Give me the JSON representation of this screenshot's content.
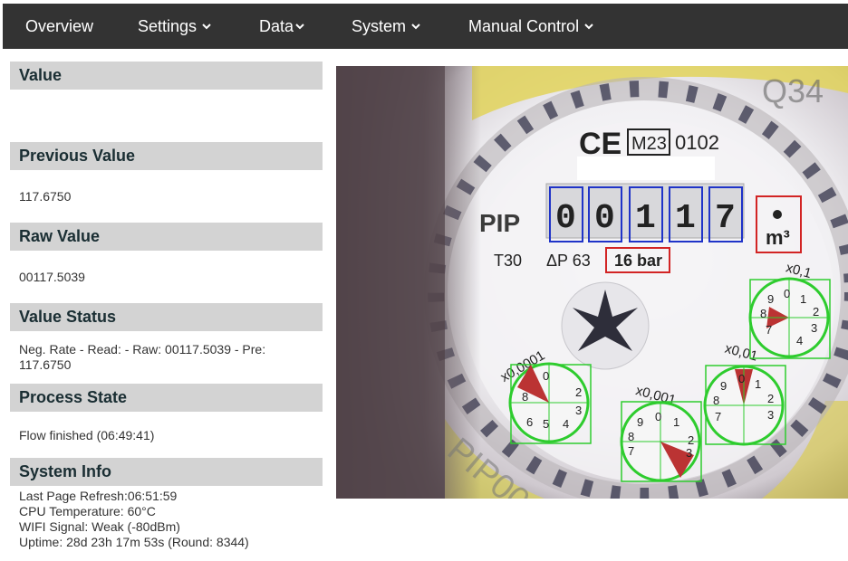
{
  "nav": {
    "items": [
      {
        "label": "Overview",
        "dropdown": false
      },
      {
        "label": "Settings",
        "dropdown": true
      },
      {
        "label": "Data",
        "dropdown": true
      },
      {
        "label": "System",
        "dropdown": true
      },
      {
        "label": "Manual Control",
        "dropdown": true
      }
    ]
  },
  "sections": {
    "value": {
      "title": "Value",
      "text": ""
    },
    "previous_value": {
      "title": "Previous Value",
      "text": "117.6750"
    },
    "raw_value": {
      "title": "Raw Value",
      "text": "00117.5039"
    },
    "value_status": {
      "title": "Value Status",
      "text": "Neg. Rate - Read: - Raw: 00117.5039 - Pre: 117.6750"
    },
    "process_state": {
      "title": "Process State",
      "text": "Flow finished (06:49:41)"
    },
    "system_info": {
      "title": "System Info",
      "last_refresh": "Last Page Refresh:06:51:59",
      "cpu_temp": "CPU Temperature: 60°C",
      "wifi": "WIFI Signal: Weak (-80dBm)",
      "uptime": "Uptime: 28d 23h 17m 53s (Round: 8344)"
    }
  },
  "meter": {
    "mark_ce": "CE",
    "mark_m23": "M23",
    "mark_0102": "0102",
    "brand": "PIP",
    "q34": "Q34",
    "t30": "T30",
    "dp63": "ΔP 63",
    "bar": "16 bar",
    "unit": "m³",
    "digits": [
      "0",
      "0",
      "1",
      "1",
      "7"
    ],
    "dial_labels": [
      "x0,0001",
      "x0,001",
      "x0,01",
      "x0,1"
    ],
    "dial_numbers": [
      "0",
      "1",
      "2",
      "3",
      "4",
      "5",
      "6",
      "7",
      "8",
      "9"
    ],
    "bottom_text": "PIP00",
    "colors": {
      "digit_box": "#1f33c8",
      "unit_box": "#d22424",
      "dial_box": "#2ecc2e"
    }
  }
}
